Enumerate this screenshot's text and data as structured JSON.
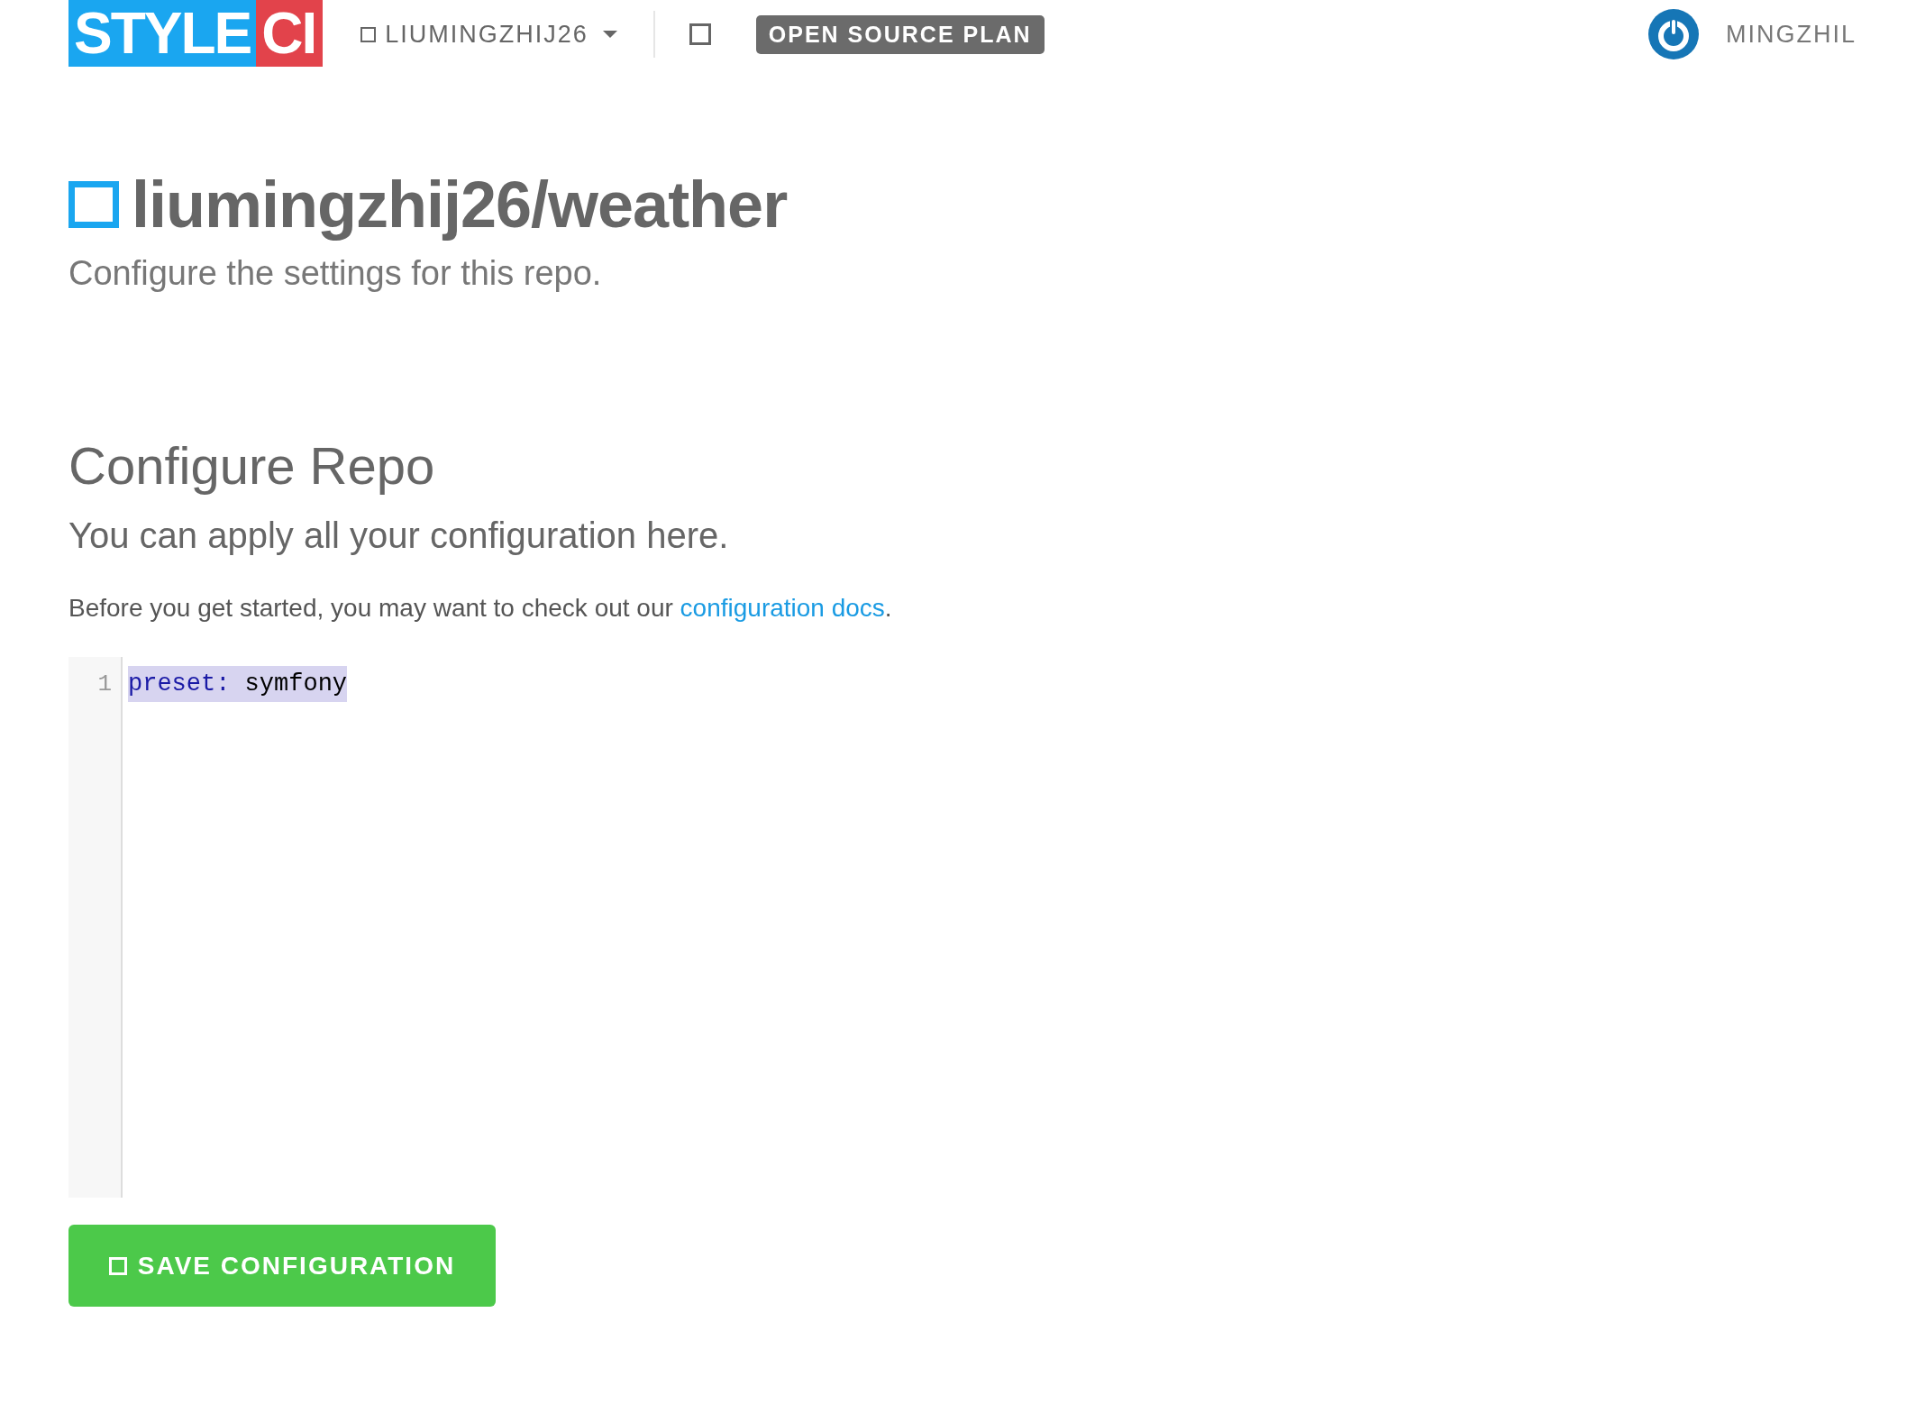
{
  "navbar": {
    "logo": {
      "left": "STYLE",
      "right": "CI"
    },
    "account_menu": {
      "label": "LIUMINGZHIJ26"
    },
    "plan_badge": "OPEN SOURCE PLAN",
    "user": {
      "name": "MINGZHIL"
    }
  },
  "header": {
    "title": "liumingzhij26/weather",
    "subtitle": "Configure the settings for this repo."
  },
  "section": {
    "title": "Configure Repo",
    "subtitle": "You can apply all your configuration here.",
    "note": {
      "before": "Before you get started, you may want to check out our ",
      "link": "configuration docs",
      "after": "."
    }
  },
  "editor": {
    "lines": [
      {
        "number": "1",
        "key": "preset:",
        "value": "symfony",
        "selected": true
      }
    ]
  },
  "save_button": {
    "label": "SAVE CONFIGURATION"
  }
}
